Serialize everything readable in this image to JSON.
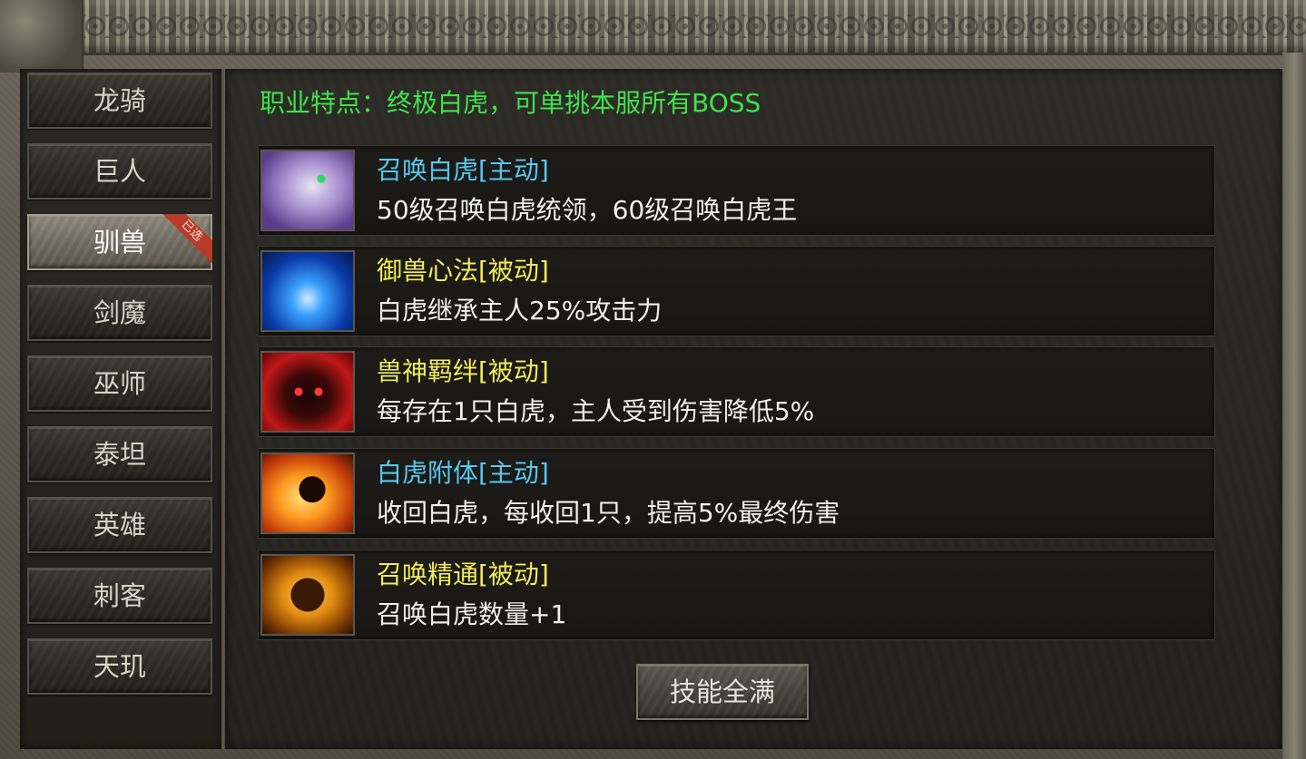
{
  "sidebar": {
    "tabs": [
      {
        "label": "龙骑",
        "active": false
      },
      {
        "label": "巨人",
        "active": false
      },
      {
        "label": "驯兽",
        "active": true,
        "badge": "已选"
      },
      {
        "label": "剑魔",
        "active": false
      },
      {
        "label": "巫师",
        "active": false
      },
      {
        "label": "泰坦",
        "active": false
      },
      {
        "label": "英雄",
        "active": false
      },
      {
        "label": "刺客",
        "active": false
      },
      {
        "label": "天玑",
        "active": false
      }
    ]
  },
  "main": {
    "feature_text": "职业特点：终极白虎，可单挑本服所有BOSS",
    "skills": [
      {
        "name": "召唤白虎[主动]",
        "desc": "50级召唤白虎统领，60级召唤白虎王",
        "icon": "white-tiger-icon"
      },
      {
        "name": "御兽心法[被动]",
        "desc": "白虎继承主人25%攻击力",
        "icon": "blue-vortex-icon"
      },
      {
        "name": "兽神羁绊[被动]",
        "desc": "每存在1只白虎，主人受到伤害降低5%",
        "icon": "red-beast-icon"
      },
      {
        "name": "白虎附体[主动]",
        "desc": "收回白虎，每收回1只，提高5%最终伤害",
        "icon": "fire-claw-icon"
      },
      {
        "name": "召唤精通[被动]",
        "desc": "召唤白虎数量+1",
        "icon": "golden-summon-icon"
      }
    ],
    "max_button_label": "技能全满"
  },
  "colors": {
    "feature_green": "#3fe34a",
    "active_skill_blue": "#55c8f0",
    "passive_skill_yellow": "#f2ec5a"
  }
}
